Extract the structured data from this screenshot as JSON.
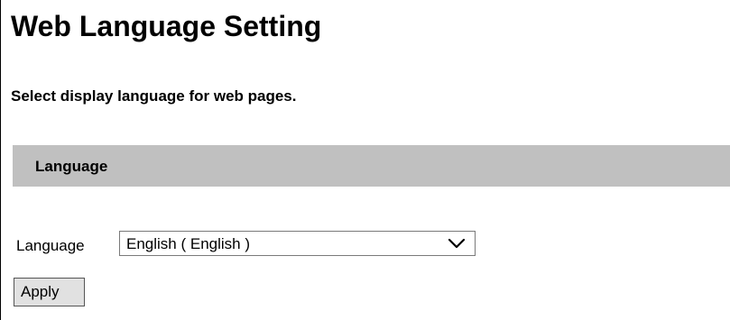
{
  "page": {
    "title": "Web Language Setting",
    "description": "Select display language for web pages."
  },
  "section": {
    "header": "Language"
  },
  "language_field": {
    "label": "Language",
    "selected_value": "English ( English )",
    "icon": "chevron-down-icon"
  },
  "actions": {
    "apply_label": "Apply"
  },
  "colors": {
    "section_header_bg": "#c0c0c0",
    "button_bg": "#e1e1e1"
  }
}
